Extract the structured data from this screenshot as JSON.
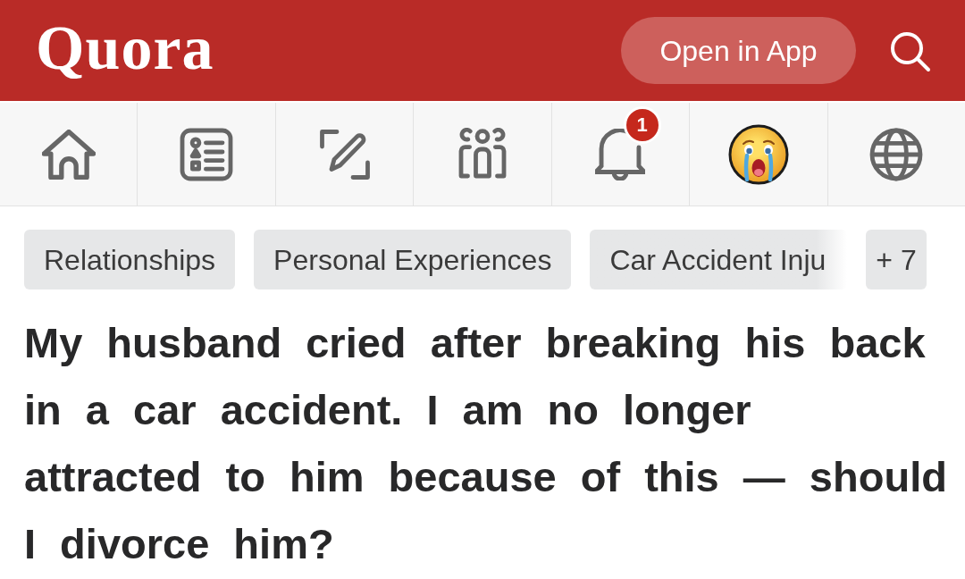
{
  "header": {
    "logo": "Quora",
    "open_in_app_button": "Open in App"
  },
  "nav": {
    "notification_badge": "1"
  },
  "topics": {
    "chips": [
      {
        "label": "Relationships",
        "truncated": false
      },
      {
        "label": "Personal Experiences",
        "truncated": false
      },
      {
        "label": "Car Accident Inju",
        "truncated": true
      }
    ],
    "more": "+ 7"
  },
  "question": {
    "title": "My husband cried after breaking his back in a car accident. I am no longer attracted to him because of this — should I divorce him?"
  }
}
